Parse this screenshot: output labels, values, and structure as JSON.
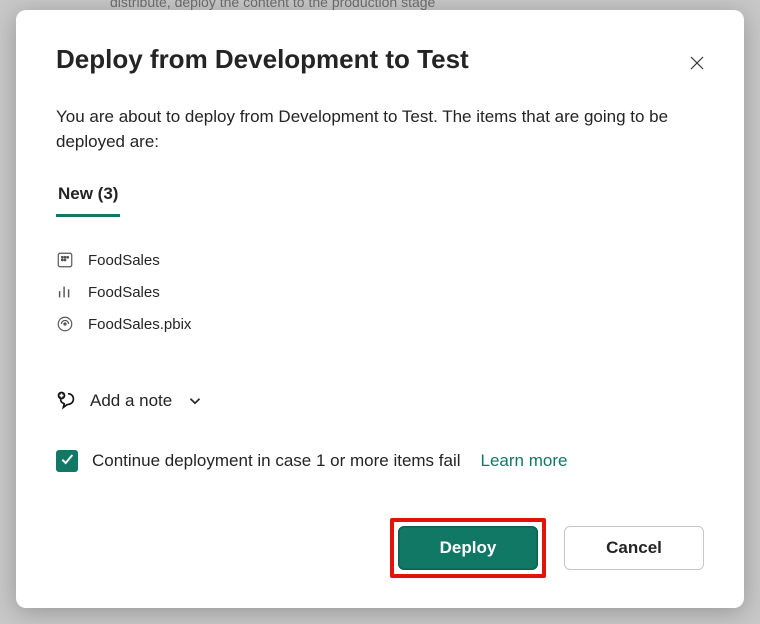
{
  "background_snippet": "distribute, deploy the content to the production stage",
  "modal": {
    "title": "Deploy from Development to Test",
    "description": "You are about to deploy from Development to Test. The items that are going to be deployed are:",
    "tab_label": "New (3)",
    "items": [
      {
        "icon": "dataset",
        "name": "FoodSales"
      },
      {
        "icon": "report",
        "name": "FoodSales"
      },
      {
        "icon": "pbix",
        "name": "FoodSales.pbix"
      }
    ],
    "add_note_label": "Add a note",
    "continue_label": "Continue deployment in case 1 or more items fail",
    "learn_more_label": "Learn more",
    "buttons": {
      "deploy": "Deploy",
      "cancel": "Cancel"
    }
  }
}
